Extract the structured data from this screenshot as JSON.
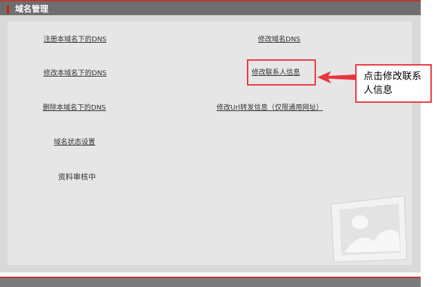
{
  "header": {
    "title": "域名管理"
  },
  "menu": {
    "register_dns": "注册本域名下的DNS",
    "modify_domain_dns": "修改域名DNS",
    "modify_dns": "修改本域名下的DNS",
    "modify_contact": "修改联系人信息",
    "delete_dns": "删除本域名下的DNS",
    "modify_url_forward": "修改Url转发信息（仅限通用网址）",
    "domain_status": "域名状态设置",
    "review_status": "资料审核中"
  },
  "annotation": {
    "callout_line1": "点击修改联系",
    "callout_line2": "人信息"
  },
  "colors": {
    "accent_red": "#e8363e",
    "title_bar": "#6e6e6e",
    "panel_bg": "#d9d9d9",
    "content_bg": "#e6e6e6"
  }
}
